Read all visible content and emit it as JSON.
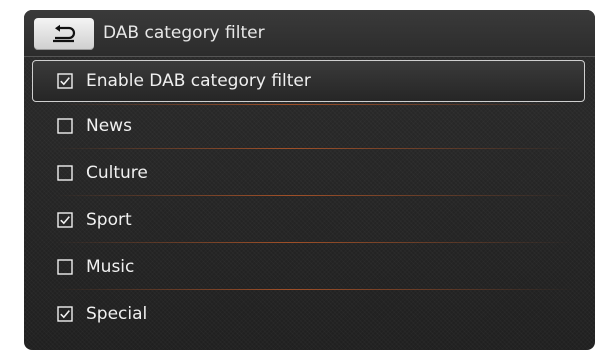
{
  "header": {
    "title": "DAB category filter"
  },
  "items": [
    {
      "label": "Enable DAB category filter",
      "checked": true
    },
    {
      "label": "News",
      "checked": false
    },
    {
      "label": "Culture",
      "checked": false
    },
    {
      "label": "Sport",
      "checked": true
    },
    {
      "label": "Music",
      "checked": false
    },
    {
      "label": "Special",
      "checked": true
    }
  ]
}
